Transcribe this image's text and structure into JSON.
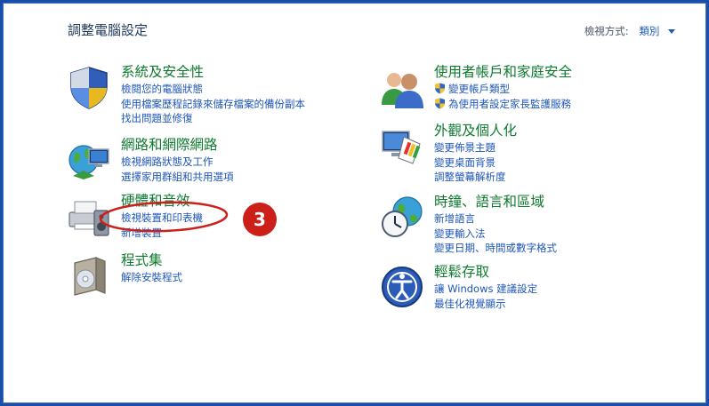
{
  "page_title": "調整電腦設定",
  "view_by": {
    "label": "檢視方式:",
    "value": "類別"
  },
  "categories": {
    "system_security": {
      "title": "系統及安全性",
      "links": [
        "檢閱您的電腦狀態",
        "使用檔案歷程記錄來儲存檔案的備份副本",
        "找出問題並修復"
      ]
    },
    "network": {
      "title": "網路和網際網路",
      "links": [
        "檢視網路狀態及工作",
        "選擇家用群組和共用選項"
      ]
    },
    "hardware_sound": {
      "title": "硬體和音效",
      "links": [
        "檢視裝置和印表機",
        "新增裝置"
      ]
    },
    "programs": {
      "title": "程式集",
      "links": [
        "解除安裝程式"
      ]
    },
    "user_accounts": {
      "title": "使用者帳戶和家庭安全",
      "links": [
        "變更帳戶類型",
        "為使用者設定家長監護服務"
      ]
    },
    "appearance": {
      "title": "外觀及個人化",
      "links": [
        "變更佈景主題",
        "變更桌面背景",
        "調整螢幕解析度"
      ]
    },
    "clock_region": {
      "title": "時鐘、語言和區域",
      "links": [
        "新增語言",
        "變更輸入法",
        "變更日期、時間或數字格式"
      ]
    },
    "ease_of_access": {
      "title": "輕鬆存取",
      "links": [
        "讓 Windows 建議設定",
        "最佳化視覺顯示"
      ]
    }
  },
  "annotation": {
    "step_number": "3",
    "color": "#cc1f1a"
  },
  "colors": {
    "title_green": "#0d7a2e",
    "link_blue": "#1e56b8",
    "border_blue": "#1a4fa8"
  }
}
